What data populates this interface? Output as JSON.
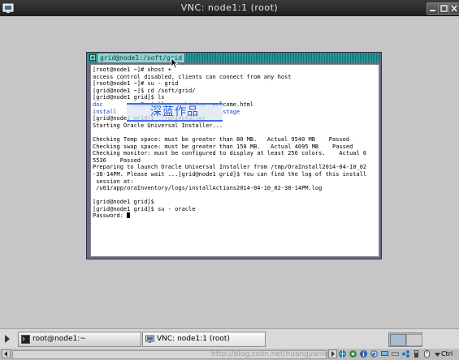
{
  "vnc_window": {
    "title": "VNC: node1:1 (root)"
  },
  "terminal_window": {
    "title": "grid@node1:/soft/grid",
    "lines": [
      {
        "text": "[root@node1 ~]# xhost +"
      },
      {
        "text": "access control disabled, clients can connect from any host"
      },
      {
        "text": "[root@node1 ~]# su - grid"
      },
      {
        "text": "[grid@node1 ~]$ cd /soft/grid/"
      },
      {
        "text": "[grid@node1 grid]$ ls"
      },
      {
        "dir1": "doc",
        "dir2": "runInstaller  sshsetup",
        "rest": "  welcome.html"
      },
      {
        "dir1": "install",
        "dir2": "                       stage",
        "rest": ""
      },
      {
        "text": "[grid@node1 grid]$ ./runInstaller"
      },
      {
        "text": "Starting Oracle Universal Installer..."
      },
      {
        "text": ""
      },
      {
        "text": "Checking Temp space: must be greater than 80 MB.   Actual 9540 MB    Passed"
      },
      {
        "text": "Checking swap space: must be greater than 150 MB.   Actual 4095 MB    Passed"
      },
      {
        "text": "Checking monitor: must be configured to display at least 256 colors.    Actual 6"
      },
      {
        "text": "5536    Passed"
      },
      {
        "text": "Preparing to launch Oracle Universal Installer from /tmp/OraInstall2014-04-10_02"
      },
      {
        "text": "-38-14PM. Please wait ...[grid@node1 grid]$ You can find the log of this install"
      },
      {
        "text": " session at:"
      },
      {
        "text": " /u01/app/oraInventory/logs/installActions2014-04-10_02-38-14PM.log"
      },
      {
        "text": ""
      },
      {
        "text": "[grid@node1 grid]$"
      },
      {
        "text": "[grid@node1 grid]$ su - oracle"
      },
      {
        "text": "Password: ",
        "cursor": true
      }
    ],
    "watermark": "深蓝作品"
  },
  "taskbar": {
    "items": [
      {
        "label": "root@node1:~"
      },
      {
        "label": "VNC: node1:1 (root)"
      }
    ]
  },
  "status_bar": {
    "watermark_url": "http://blog.csdn.net/huangyanlong",
    "keyboard_label": "Ctrl"
  },
  "colors": {
    "terminal_titlebar": "#2aa6a0",
    "terminal_bg": "#ffffff",
    "directory_text": "#1a3fc4",
    "watermark_text": "#1d5fe0"
  }
}
